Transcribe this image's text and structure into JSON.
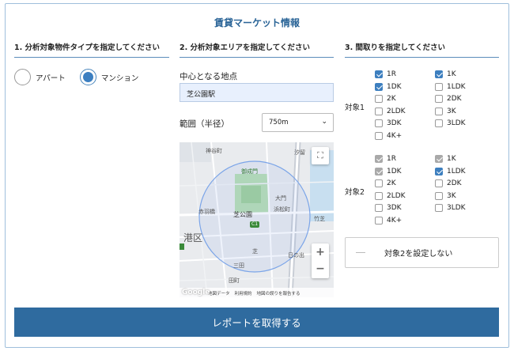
{
  "title": "賃貸マーケット情報",
  "section1": {
    "heading": "1. 分析対象物件タイプを指定してください",
    "options": [
      {
        "label": "アパート",
        "selected": false
      },
      {
        "label": "マンション",
        "selected": true
      }
    ]
  },
  "section2": {
    "heading": "2. 分析対象エリアを指定してください",
    "center_label": "中心となる地点",
    "center_value": "芝公園駅",
    "range_label": "範囲（半径）",
    "range_value": "750m",
    "map": {
      "labels": [
        "神谷町",
        "汐留",
        "御成門",
        "大門",
        "浜松町",
        "竹芝",
        "赤羽橋",
        "芝公園",
        "港区",
        "芝",
        "日の出",
        "三田",
        "田町"
      ],
      "footer": [
        "地図データ",
        "利用規約",
        "地図の誤りを報告する"
      ],
      "google": "Google",
      "zoom_in": "+",
      "zoom_out": "−",
      "c1": "C1"
    }
  },
  "section3": {
    "heading": "3. 間取りを指定してください",
    "target1": {
      "label": "対象1",
      "col1": [
        {
          "t": "1R",
          "c": true
        },
        {
          "t": "1DK",
          "c": true
        },
        {
          "t": "2K",
          "c": false
        },
        {
          "t": "2LDK",
          "c": false
        },
        {
          "t": "3DK",
          "c": false
        },
        {
          "t": "4K+",
          "c": false
        }
      ],
      "col2": [
        {
          "t": "1K",
          "c": true
        },
        {
          "t": "1LDK",
          "c": false
        },
        {
          "t": "2DK",
          "c": false
        },
        {
          "t": "3K",
          "c": false
        },
        {
          "t": "3LDK",
          "c": false
        }
      ]
    },
    "target2": {
      "label": "対象2",
      "col1": [
        {
          "t": "1R",
          "c": true
        },
        {
          "t": "1DK",
          "c": true
        },
        {
          "t": "2K",
          "c": false
        },
        {
          "t": "2LDK",
          "c": false
        },
        {
          "t": "3DK",
          "c": false
        },
        {
          "t": "4K+",
          "c": false
        }
      ],
      "col2": [
        {
          "t": "1K",
          "c": true
        },
        {
          "t": "1LDK",
          "c": true
        },
        {
          "t": "2DK",
          "c": false
        },
        {
          "t": "3K",
          "c": false
        },
        {
          "t": "3LDK",
          "c": false
        }
      ]
    },
    "toggle_label": "対象2を設定しない"
  },
  "submit_label": "レポートを取得する"
}
